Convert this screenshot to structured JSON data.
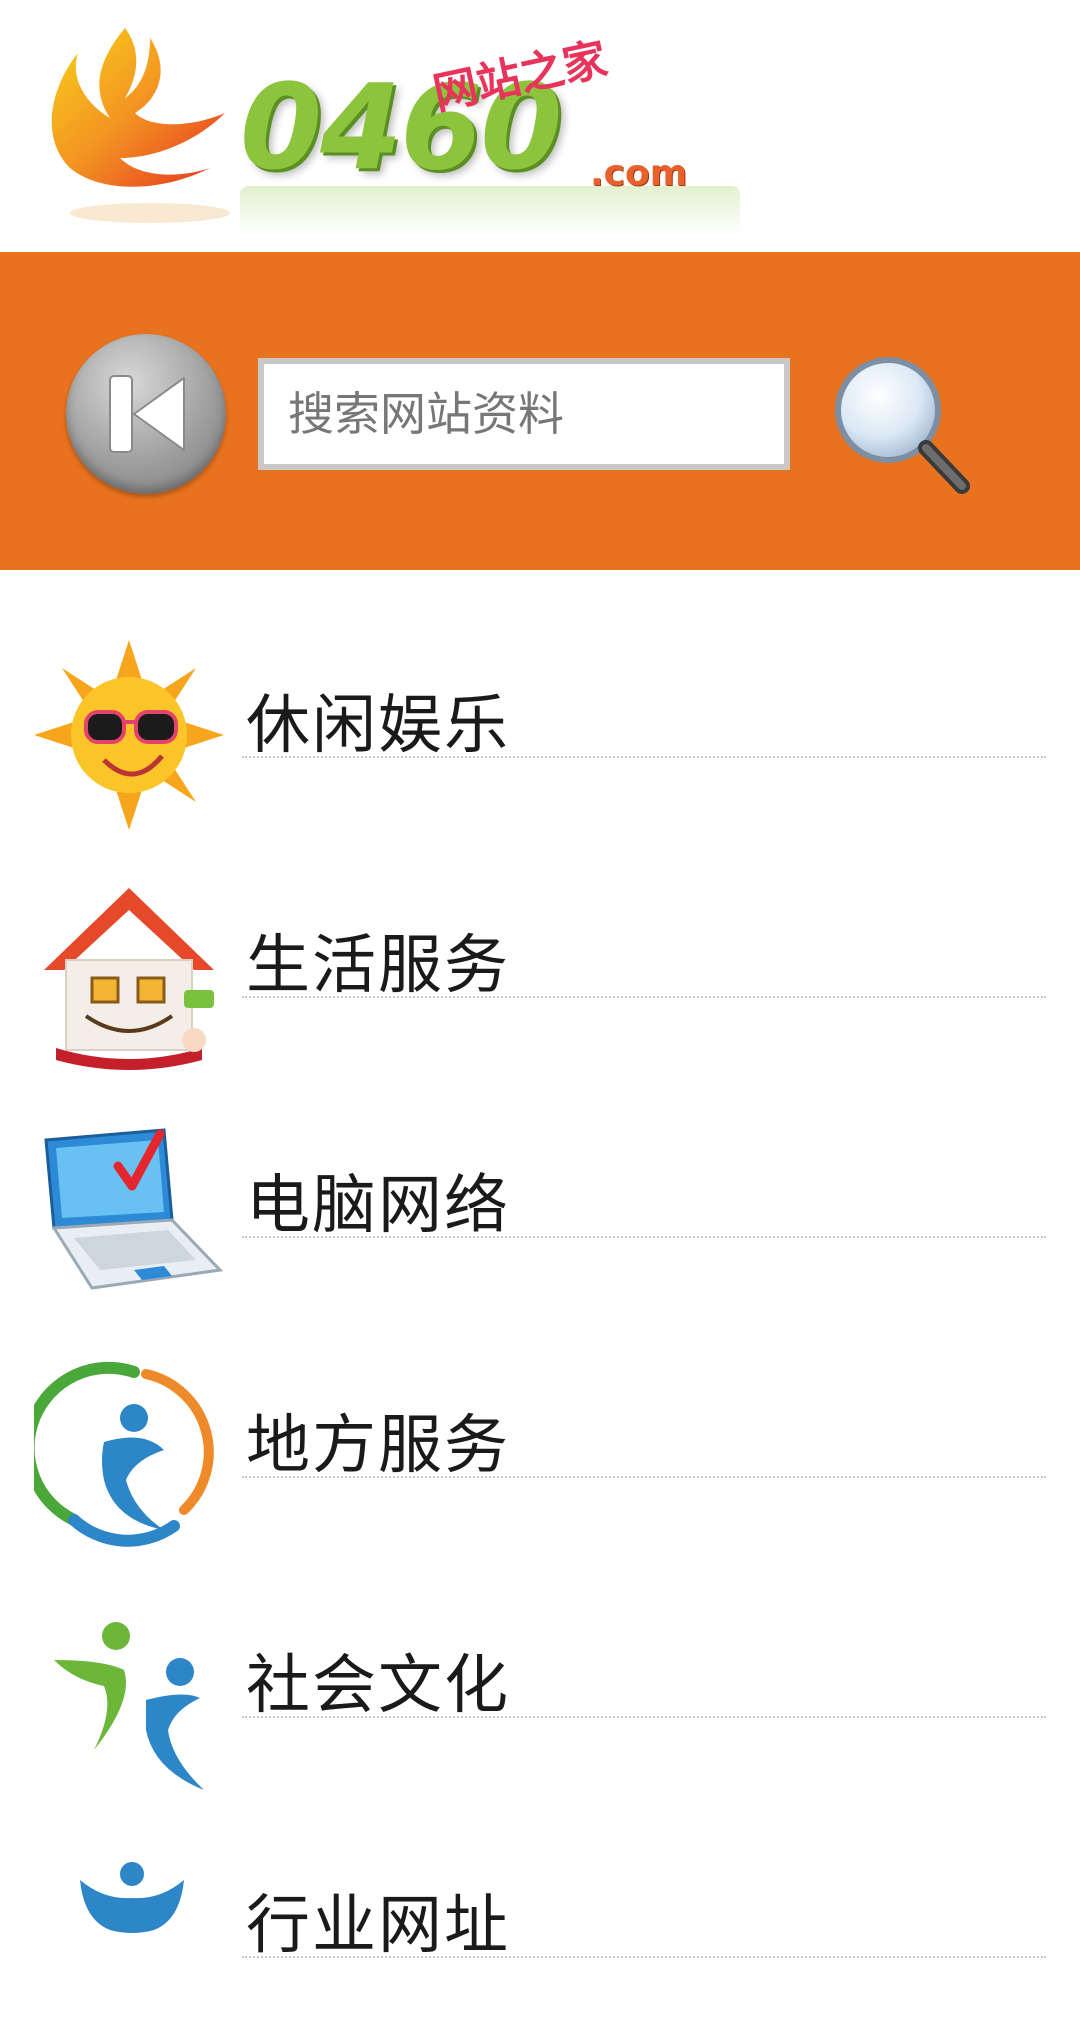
{
  "header": {
    "logo_text": "0460",
    "logo_com": ".com",
    "logo_cn": "网站之家"
  },
  "search": {
    "placeholder": "搜索网站资料"
  },
  "colors": {
    "accent_orange": "#e8721e",
    "logo_green": "#8cc43d"
  },
  "categories": [
    {
      "label": "休闲娱乐",
      "icon": "sun-sunglasses-icon"
    },
    {
      "label": "生活服务",
      "icon": "smiling-house-icon"
    },
    {
      "label": "电脑网络",
      "icon": "laptop-checkmark-icon"
    },
    {
      "label": "地方服务",
      "icon": "person-circle-icon"
    },
    {
      "label": "社会文化",
      "icon": "two-people-dancing-icon"
    },
    {
      "label": "行业网址",
      "icon": "person-hands-up-icon"
    }
  ]
}
